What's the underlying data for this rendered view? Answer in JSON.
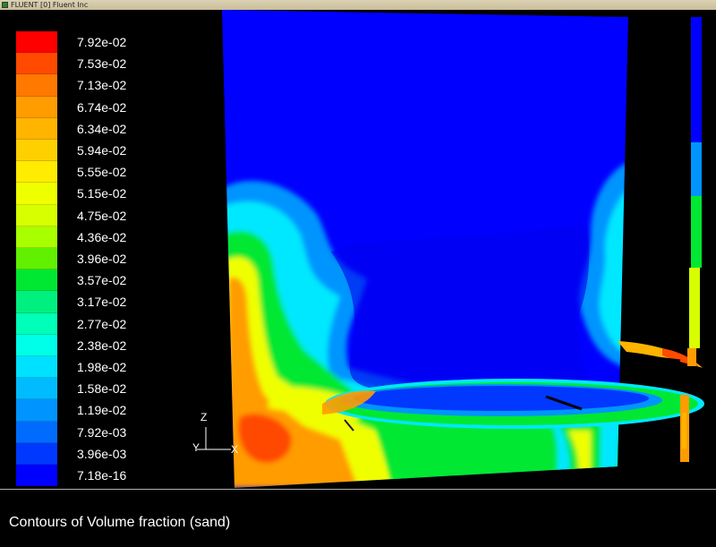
{
  "window": {
    "title": "FLUENT [0] Fluent Inc"
  },
  "legend": {
    "values": [
      "7.92e-02",
      "7.53e-02",
      "7.13e-02",
      "6.74e-02",
      "6.34e-02",
      "5.94e-02",
      "5.55e-02",
      "5.15e-02",
      "4.75e-02",
      "4.36e-02",
      "3.96e-02",
      "3.57e-02",
      "3.17e-02",
      "2.77e-02",
      "2.38e-02",
      "1.98e-02",
      "1.58e-02",
      "1.19e-02",
      "7.92e-03",
      "3.96e-03",
      "7.18e-16"
    ],
    "colors": [
      "#ff0000",
      "#ff4a00",
      "#ff7800",
      "#ff9c00",
      "#ffb400",
      "#ffd000",
      "#ffec00",
      "#f0ff00",
      "#d8ff00",
      "#a8ff00",
      "#60f000",
      "#00e832",
      "#00f080",
      "#00ffb8",
      "#00ffe8",
      "#00e0ff",
      "#00bcff",
      "#0094ff",
      "#006cff",
      "#0038ff",
      "#0000ff"
    ]
  },
  "axes": {
    "z_label": "Z",
    "y_label": "Y",
    "x_label": "X"
  },
  "caption": "Contours of Volume fraction (sand)",
  "field_colors": {
    "background": "#0000ff",
    "low": "#0038ff",
    "cyan": "#00e8ff",
    "green": "#00e832",
    "yellow": "#f0ff00",
    "orange": "#ff9c00",
    "red": "#ff4a00"
  }
}
